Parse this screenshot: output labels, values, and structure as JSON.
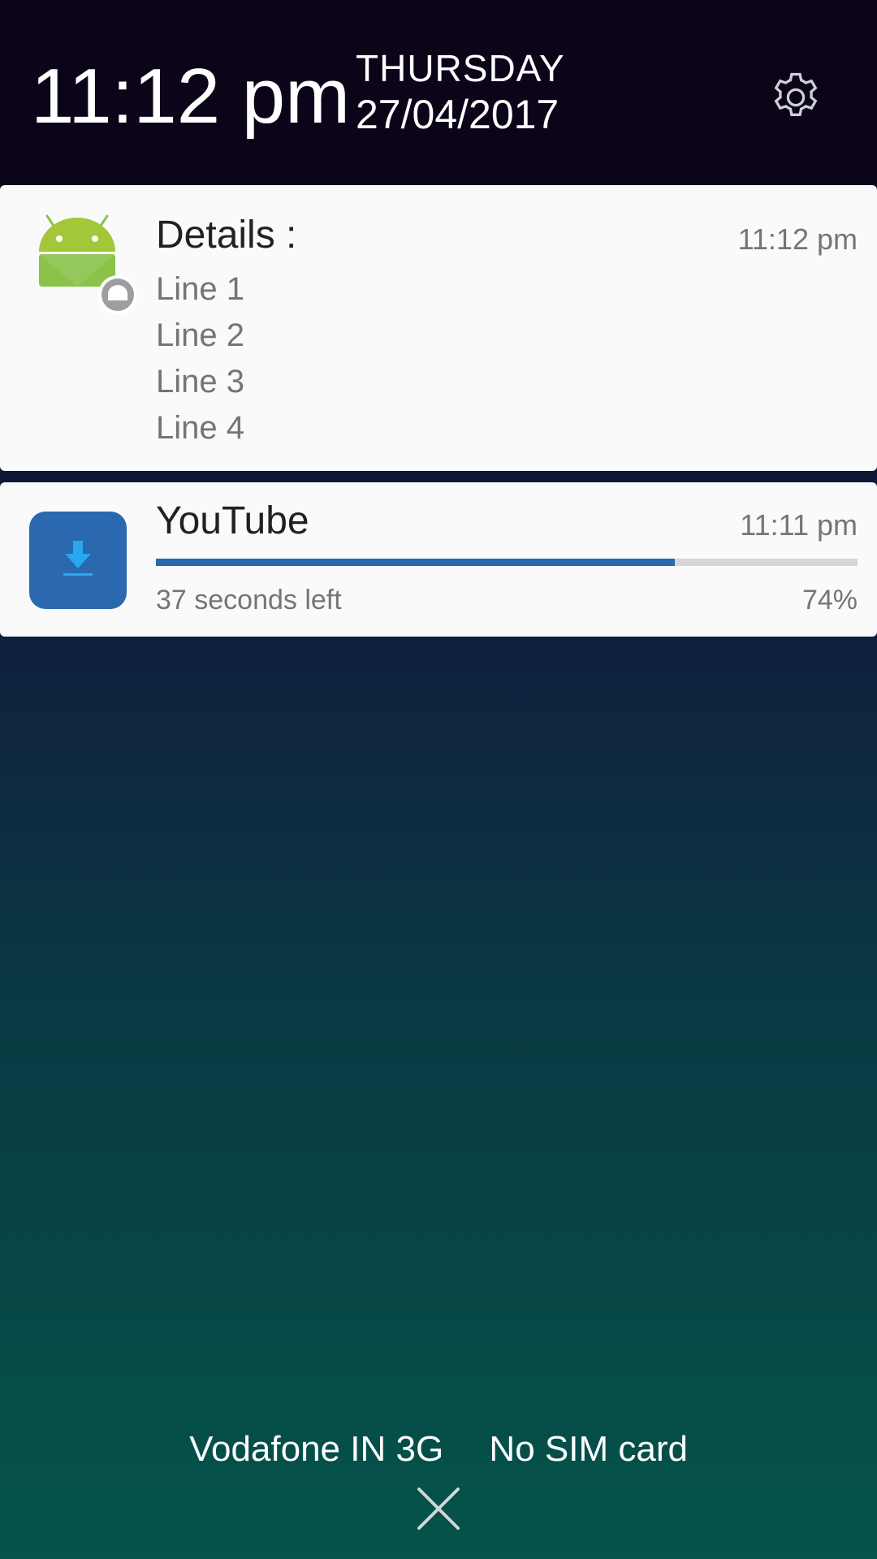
{
  "header": {
    "time": "11:12 pm",
    "day": "THURSDAY",
    "date": "27/04/2017",
    "settings_icon": "gear-icon"
  },
  "notifications": [
    {
      "app_icon": "android-icon",
      "badge_icon": "android-badge-icon",
      "title": "Details :",
      "time": "11:12 pm",
      "lines": [
        "Line 1",
        "Line 2",
        "Line 3",
        "Line 4"
      ]
    },
    {
      "app_icon": "download-icon",
      "title": "YouTube",
      "time": "11:11 pm",
      "subtitle": "37 seconds left",
      "percent_label": "74%",
      "progress": 0.74
    }
  ],
  "footer": {
    "carrier_1": "Vodafone IN 3G",
    "carrier_2": "No SIM card",
    "close_icon": "close-icon"
  },
  "colors": {
    "accent": "#2a68b0",
    "android_green": "#8bc34a",
    "card_bg": "#fafafa"
  }
}
